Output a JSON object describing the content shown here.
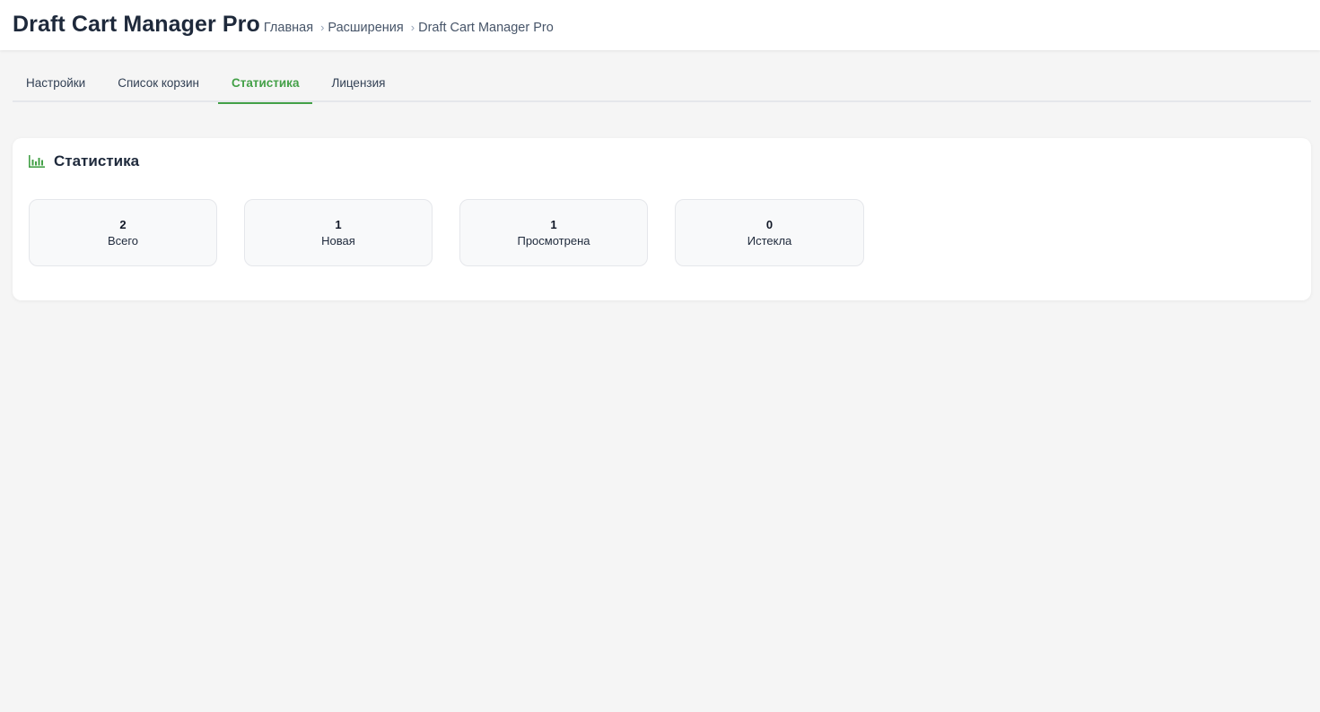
{
  "header": {
    "title": "Draft Cart Manager Pro",
    "breadcrumb": [
      "Главная",
      "Расширения",
      "Draft Cart Manager Pro"
    ]
  },
  "tabs": [
    {
      "label": "Настройки"
    },
    {
      "label": "Список корзин"
    },
    {
      "label": "Статистика",
      "active": true
    },
    {
      "label": "Лицензия"
    }
  ],
  "stats_card": {
    "title": "Статистика",
    "icon": "bar-chart-icon",
    "items": [
      {
        "value": "2",
        "label": "Всего"
      },
      {
        "value": "1",
        "label": "Новая"
      },
      {
        "value": "1",
        "label": "Просмотрена"
      },
      {
        "value": "0",
        "label": "Истекла"
      }
    ]
  },
  "colors": {
    "accent": "#43a047",
    "background": "#f5f5f5"
  }
}
